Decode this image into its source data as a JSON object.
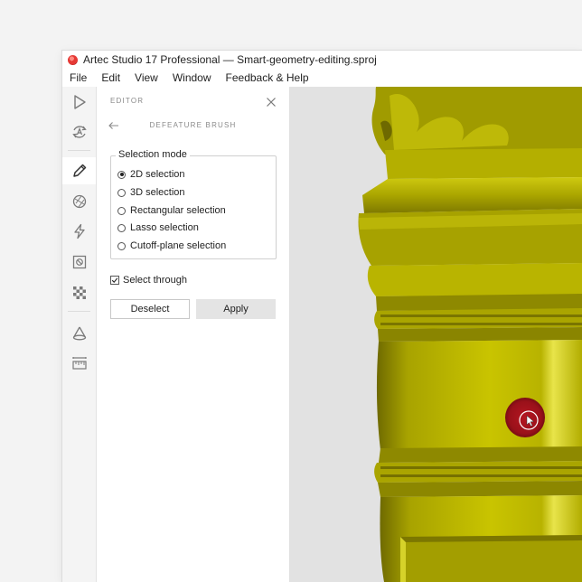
{
  "window": {
    "title": "Artec Studio 17 Professional — Smart-geometry-editing.sproj"
  },
  "menu": [
    "File",
    "Edit",
    "View",
    "Window",
    "Feedback & Help"
  ],
  "toolbar": {
    "tools": [
      {
        "name": "play-icon"
      },
      {
        "name": "autopilot-icon"
      },
      {
        "name": "pencil-icon",
        "active": true
      },
      {
        "name": "texture-icon"
      },
      {
        "name": "lightning-icon"
      },
      {
        "name": "eraser-icon"
      },
      {
        "name": "checker-icon"
      },
      {
        "name": "cone-icon"
      },
      {
        "name": "ruler-icon"
      }
    ]
  },
  "editor": {
    "title": "EDITOR",
    "subtitle": "DEFEATURE BRUSH",
    "selection_mode": {
      "legend": "Selection mode",
      "options": [
        {
          "label": "2D selection",
          "checked": true
        },
        {
          "label": "3D selection",
          "checked": false
        },
        {
          "label": "Rectangular selection",
          "checked": false
        },
        {
          "label": "Lasso selection",
          "checked": false
        },
        {
          "label": "Cutoff-plane selection",
          "checked": false
        }
      ]
    },
    "select_through": {
      "label": "Select through",
      "checked": true
    },
    "buttons": {
      "deselect": "Deselect",
      "apply": "Apply"
    }
  },
  "colors": {
    "model": "#b5b000",
    "model_dark": "#6f6a00",
    "model_light": "#e6e23a",
    "viewport_bg": "#e2e2e2",
    "brush": "#a3121b"
  }
}
